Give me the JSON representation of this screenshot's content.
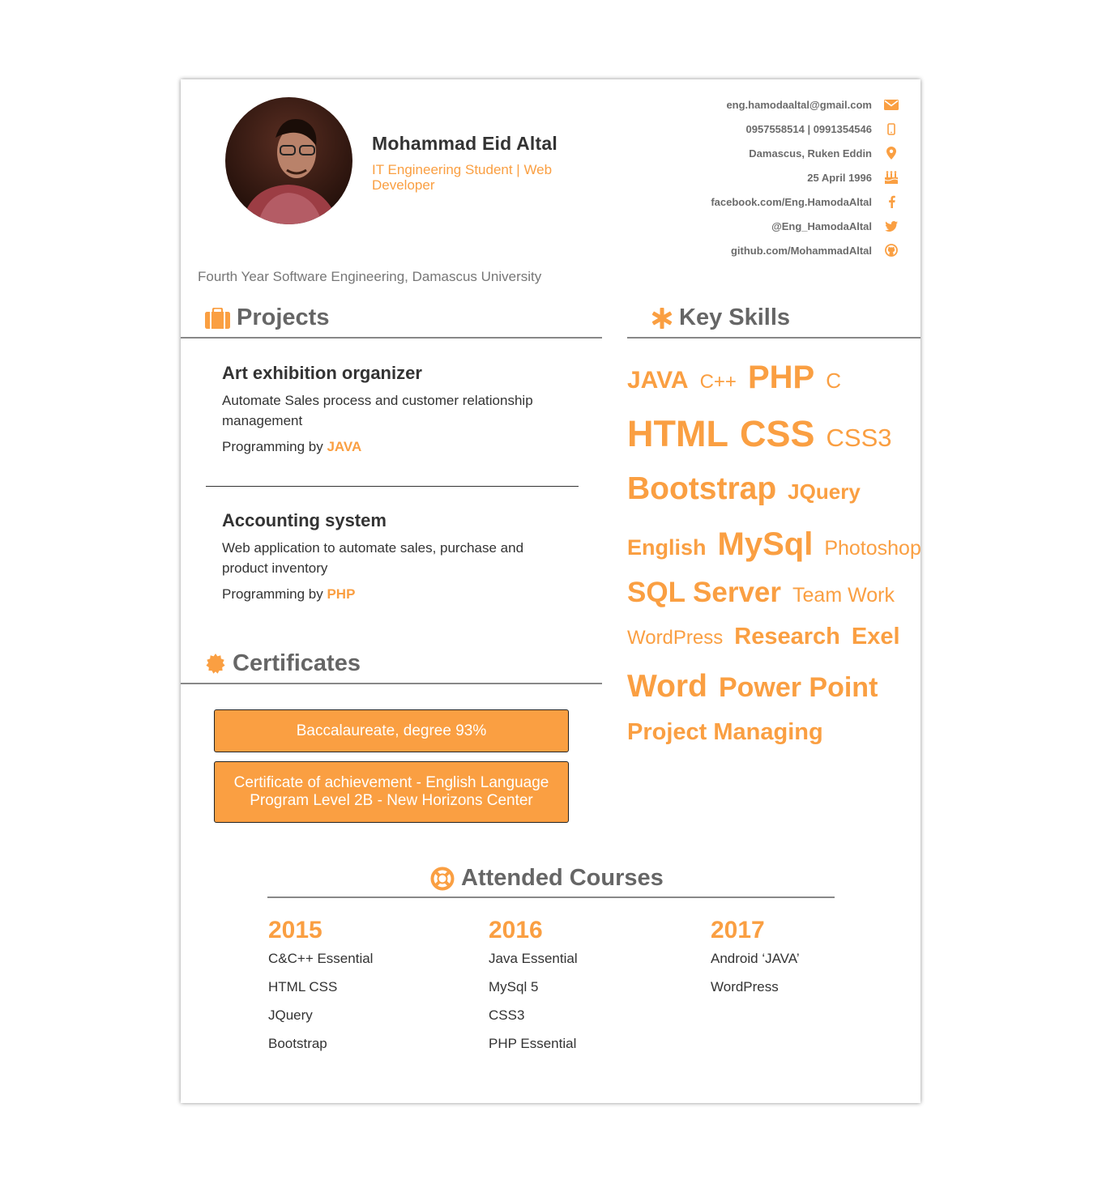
{
  "profile": {
    "name": "Mohammad Eid Altal",
    "subtitle": "IT Engineering Student | Web Developer",
    "education": "Fourth Year Software Engineering, Damascus University"
  },
  "contacts": [
    {
      "text": "eng.hamodaaltal@gmail.com",
      "icon": "envelope-icon"
    },
    {
      "text": "0957558514 | 0991354546",
      "icon": "mobile-icon"
    },
    {
      "text": "Damascus, Ruken Eddin",
      "icon": "map-marker-icon"
    },
    {
      "text": "25 April 1996",
      "icon": "birthday-cake-icon"
    },
    {
      "text": "facebook.com/Eng.HamodaAltal",
      "icon": "facebook-icon"
    },
    {
      "text": "@Eng_HamodaAltal",
      "icon": "twitter-icon"
    },
    {
      "text": "github.com/MohammadAltal",
      "icon": "github-icon"
    }
  ],
  "projects": {
    "title": "Projects",
    "items": [
      {
        "title": "Art exhibition organizer",
        "description": "Automate Sales process and customer relationship management",
        "prefix": "Programming by",
        "lang": "JAVA"
      },
      {
        "title": "Accounting system",
        "description": "Web application to automate sales, purchase and product inventory",
        "prefix": "Programming by",
        "lang": "PHP"
      }
    ]
  },
  "certificates": {
    "title": "Certificates",
    "items": [
      "Baccalaureate, degree 93%",
      "Certificate of achievement - English Language Program Level 2B - New Horizons Center"
    ]
  },
  "skills": {
    "title": "Key Skills",
    "lines": [
      [
        "JAVA",
        "C++",
        "PHP",
        "C"
      ],
      [
        "HTML",
        "CSS",
        "CSS3"
      ],
      [
        "Bootstrap",
        "JQuery"
      ],
      [
        "English",
        "MySql",
        "Photoshop"
      ],
      [
        "SQL Server",
        "Team Work"
      ],
      [
        "WordPress",
        "Research",
        "Exel"
      ],
      [
        "Word",
        "Power Point"
      ],
      [
        "Project Managing"
      ]
    ]
  },
  "courses": {
    "title": "Attended Courses",
    "years": [
      {
        "year": "2015",
        "items": [
          "C&C++ Essential",
          "HTML CSS",
          "JQuery",
          "Bootstrap"
        ]
      },
      {
        "year": "2016",
        "items": [
          "Java Essential",
          "MySql 5",
          "CSS3",
          "PHP Essential"
        ]
      },
      {
        "year": "2017",
        "items": [
          "Android ‘JAVA’",
          "WordPress"
        ]
      }
    ]
  },
  "colors": {
    "accent": "#fa9f42",
    "text": "#333333",
    "muted": "#666666"
  }
}
